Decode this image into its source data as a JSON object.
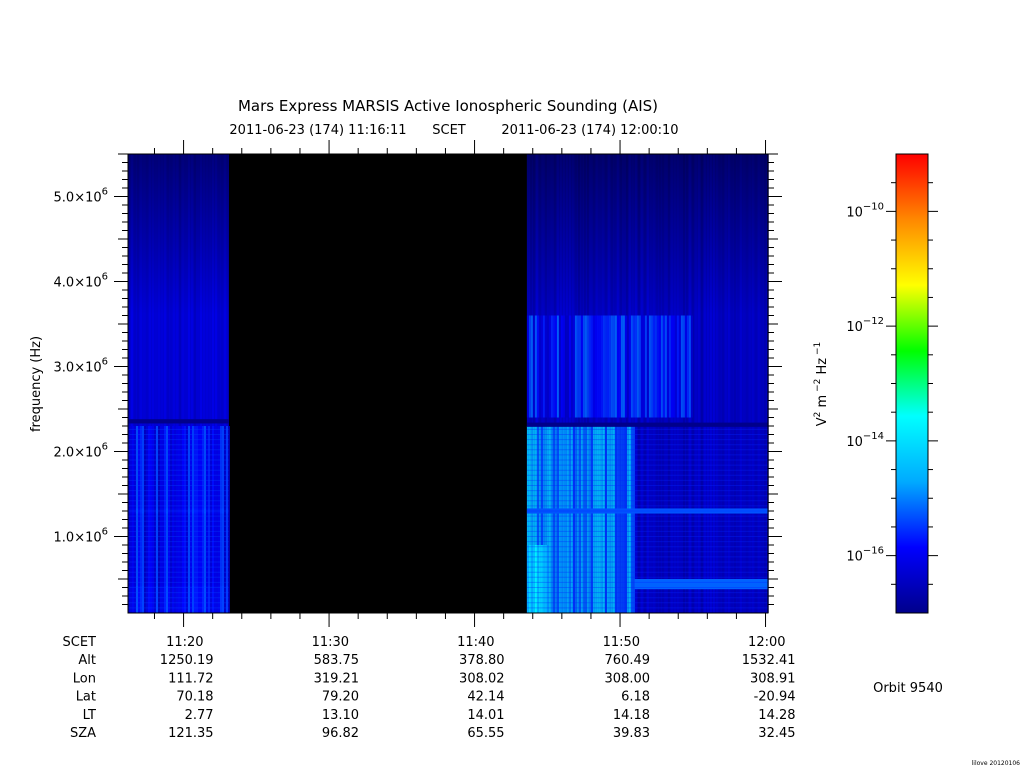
{
  "title": "Mars Express MARSIS Active Ionospheric Sounding (AIS)",
  "time_range": {
    "start": "2011-06-23 (174) 11:16:11",
    "frame": "SCET",
    "end": "2011-06-23 (174) 12:00:10"
  },
  "ylabel": "frequency (Hz)",
  "colorbar": {
    "label_parts": [
      "V",
      "2",
      " m",
      " −2",
      " Hz",
      " −1"
    ],
    "colors": [
      "#00008b",
      "#0000ff",
      "#00aaff",
      "#00ffff",
      "#00ff00",
      "#ffff00",
      "#ff8800",
      "#ff0000"
    ],
    "ticks": [
      {
        "base": "10",
        "exp": "−10",
        "value_log": -10
      },
      {
        "base": "10",
        "exp": "−12",
        "value_log": -12
      },
      {
        "base": "10",
        "exp": "−14",
        "value_log": -14
      },
      {
        "base": "10",
        "exp": "−16",
        "value_log": -16
      }
    ],
    "range_log": [
      -17,
      -9
    ]
  },
  "ephemeris": {
    "row_labels": [
      "SCET",
      "Alt",
      "Lon",
      "Lat",
      "LT",
      "SZA"
    ],
    "columns": [
      {
        "SCET": "11:20",
        "Alt": "1250.19",
        "Lon": "111.72",
        "Lat": "70.18",
        "LT": "2.77",
        "SZA": "121.35"
      },
      {
        "SCET": "11:30",
        "Alt": "583.75",
        "Lon": "319.21",
        "Lat": "79.20",
        "LT": "13.10",
        "SZA": "96.82"
      },
      {
        "SCET": "11:40",
        "Alt": "378.80",
        "Lon": "308.02",
        "Lat": "42.14",
        "LT": "14.01",
        "SZA": "65.55"
      },
      {
        "SCET": "11:50",
        "Alt": "760.49",
        "Lon": "308.00",
        "Lat": "6.18",
        "LT": "14.18",
        "SZA": "39.83"
      },
      {
        "SCET": "12:00",
        "Alt": "1532.41",
        "Lon": "308.91",
        "Lat": "-20.94",
        "LT": "14.28",
        "SZA": "32.45"
      }
    ]
  },
  "orbit_label": "Orbit 9540",
  "footer_stamp": "lilove 20120106",
  "chart_data": {
    "type": "heatmap",
    "title": "Mars Express MARSIS Active Ionospheric Sounding (AIS)",
    "xlabel": "SCET",
    "ylabel": "frequency (Hz)",
    "x_unit": "minutes after 11:00 SCET",
    "xlim": [
      16.18,
      60.17
    ],
    "ylim": [
      100000,
      5500000
    ],
    "x_ticks": [
      {
        "label": "11:20",
        "value": 20
      },
      {
        "label": "11:30",
        "value": 30
      },
      {
        "label": "11:40",
        "value": 40
      },
      {
        "label": "11:50",
        "value": 50
      },
      {
        "label": "12:00",
        "value": 60
      }
    ],
    "y_ticks": [
      {
        "mant": "1.0×10",
        "exp": "6",
        "value": 1000000
      },
      {
        "mant": "2.0×10",
        "exp": "6",
        "value": 2000000
      },
      {
        "mant": "3.0×10",
        "exp": "6",
        "value": 3000000
      },
      {
        "mant": "4.0×10",
        "exp": "6",
        "value": 4000000
      },
      {
        "mant": "5.0×10",
        "exp": "6",
        "value": 5000000
      }
    ],
    "data_gap": {
      "start": 23.1,
      "end": 43.6
    },
    "segments": [
      {
        "name": "segment-1",
        "start": 16.18,
        "end": 23.1,
        "base_log": -16.3,
        "features": [
          {
            "kind": "band",
            "f_min": 2330000,
            "f_max": 2380000,
            "log": -17.5
          },
          {
            "kind": "band",
            "f_min": 1270000,
            "f_max": 1330000,
            "log": -15.5
          },
          {
            "kind": "band",
            "f_min": 120000,
            "f_max": 420000,
            "log": -15.6
          },
          {
            "kind": "region",
            "f_min": 100000,
            "f_max": 2300000,
            "log": -15.9
          }
        ]
      },
      {
        "name": "segment-2",
        "start": 43.6,
        "end": 60.17,
        "base_log": -16.5,
        "features": [
          {
            "kind": "region",
            "t_start": 43.6,
            "t_end": 51.0,
            "f_min": 100000,
            "f_max": 2300000,
            "log": -14.8
          },
          {
            "kind": "region",
            "t_start": 43.6,
            "t_end": 45.0,
            "f_min": 100000,
            "f_max": 900000,
            "log": -14.3
          },
          {
            "kind": "region",
            "t_start": 43.6,
            "t_end": 55.0,
            "f_min": 2400000,
            "f_max": 3600000,
            "log": -15.8
          },
          {
            "kind": "band",
            "f_min": 2290000,
            "f_max": 2340000,
            "log": -17.8
          },
          {
            "kind": "band",
            "f_min": 1270000,
            "f_max": 1330000,
            "log": -15.3
          },
          {
            "kind": "band",
            "t_start": 51.0,
            "t_end": 60.17,
            "f_min": 380000,
            "f_max": 500000,
            "log": -15.2
          }
        ]
      }
    ],
    "color_scale_log": [
      -17,
      -9
    ]
  }
}
